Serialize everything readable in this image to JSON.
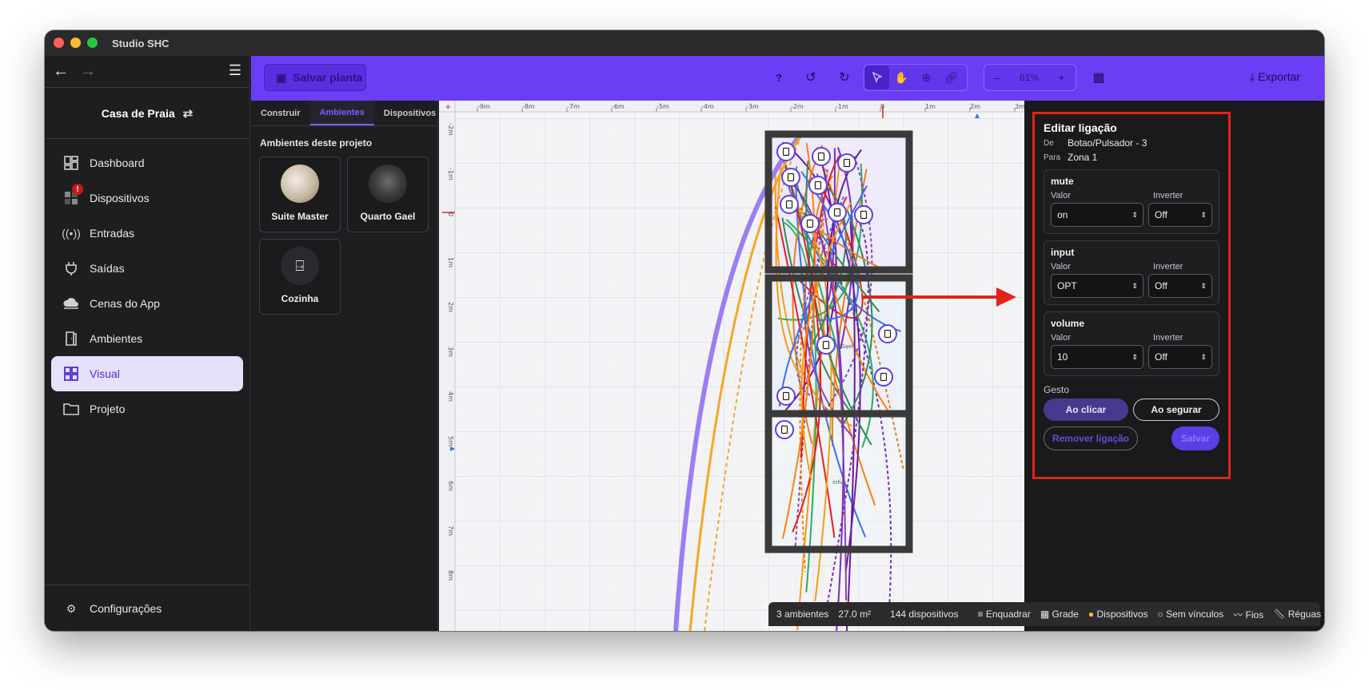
{
  "window": {
    "title": "Studio SHC"
  },
  "sidebar": {
    "project_name": "Casa de Praia",
    "items": [
      {
        "label": "Dashboard",
        "icon": "dashboard-icon"
      },
      {
        "label": "Dispositivos",
        "icon": "devices-icon",
        "badge": "!"
      },
      {
        "label": "Entradas",
        "icon": "broadcast-icon"
      },
      {
        "label": "Saídas",
        "icon": "plug-icon"
      },
      {
        "label": "Cenas do App",
        "icon": "cloud-icon"
      },
      {
        "label": "Ambientes",
        "icon": "door-icon"
      },
      {
        "label": "Visual",
        "icon": "grid-icon",
        "active": true
      },
      {
        "label": "Projeto",
        "icon": "folder-icon"
      }
    ],
    "settings_label": "Configurações"
  },
  "toolbar": {
    "save_label": "Salvar planta",
    "help": "?",
    "zoom_minus": "–",
    "zoom_value": "61%",
    "zoom_plus": "+",
    "export_label": "Exportar"
  },
  "left_panel": {
    "tabs": [
      "Construir",
      "Ambientes",
      "Dispositivos"
    ],
    "active_tab": "Ambientes",
    "section_title": "Ambientes deste projeto",
    "rooms": [
      "Suite Master",
      "Quarto Gael",
      "Cozinha"
    ]
  },
  "canvas": {
    "ruler_top": [
      "-9m",
      "-8m",
      "-7m",
      "-6m",
      "-5m",
      "-4m",
      "-3m",
      "-2m",
      "-1m",
      "0",
      "1m",
      "2m",
      "3m"
    ],
    "ruler_left": [
      "-2m",
      "-1m",
      "0",
      "1m",
      "2m",
      "3m",
      "4m",
      "5m",
      "6m",
      "7m",
      "8m"
    ],
    "room_labels": [
      "Gael",
      "inha"
    ]
  },
  "edit_link": {
    "title": "Editar ligação",
    "from_key": "De",
    "from_value": "Botao/Pulsador - 3",
    "to_key": "Para",
    "to_value": "Zona 1",
    "value_header": "Valor",
    "invert_header": "Inverter",
    "params": [
      {
        "name": "mute",
        "value": "on",
        "invert": "Off"
      },
      {
        "name": "input",
        "value": "OPT",
        "invert": "Off"
      },
      {
        "name": "volume",
        "value": "10",
        "invert": "Off"
      }
    ],
    "gesture_label": "Gesto",
    "gesture_click": "Ao clicar",
    "gesture_hold": "Ao segurar",
    "remove_label": "Remover ligação",
    "save_label": "Salvar"
  },
  "status": {
    "rooms": "3 ambientes",
    "area": "27.0 m²",
    "devices": "144 dispositivos",
    "fit": "Enquadrar",
    "grid": "Grade",
    "devices_toggle": "Dispositivos",
    "no_links": "Sem vínculos",
    "wires": "Fios",
    "rulers": "Réguas"
  },
  "colors": {
    "accent": "#6b3df5",
    "highlight": "#e0241b",
    "active_nav_bg": "#e6e0fb"
  }
}
